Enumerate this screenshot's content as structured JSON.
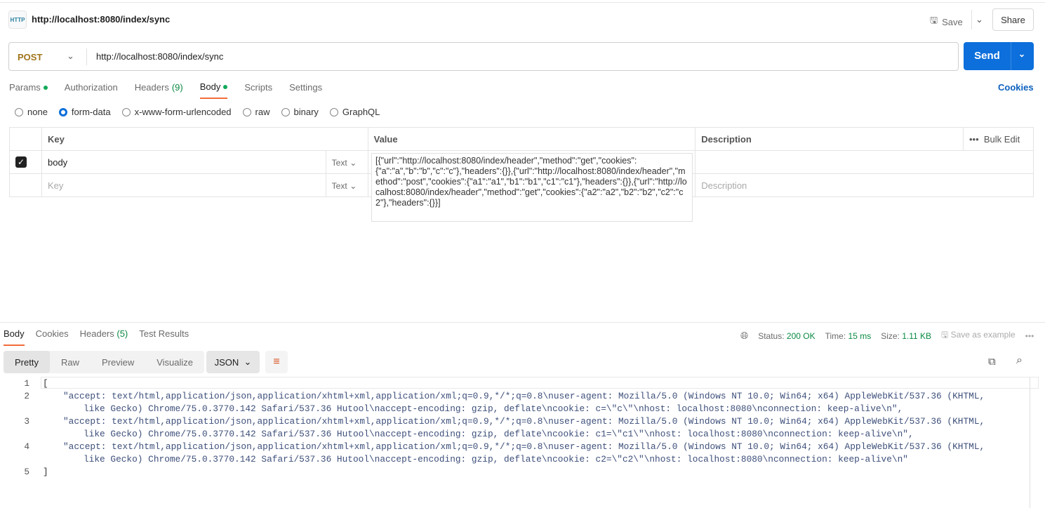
{
  "header": {
    "icon": "http-icon",
    "icon_text": "HTTP",
    "title": "http://localhost:8080/index/sync",
    "save_label": "Save",
    "share_label": "Share"
  },
  "request": {
    "method": "POST",
    "url": "http://localhost:8080/index/sync",
    "send_label": "Send"
  },
  "tabs": [
    {
      "label": "Params",
      "dot": true
    },
    {
      "label": "Authorization"
    },
    {
      "label": "Headers",
      "count": "(9)"
    },
    {
      "label": "Body",
      "dot": true,
      "active": true
    },
    {
      "label": "Scripts"
    },
    {
      "label": "Settings"
    }
  ],
  "cookies_link": "Cookies",
  "body_types": [
    "none",
    "form-data",
    "x-www-form-urlencoded",
    "raw",
    "binary",
    "GraphQL"
  ],
  "body_type_selected": "form-data",
  "table": {
    "headers": {
      "key": "Key",
      "value": "Value",
      "description": "Description",
      "bulk_edit": "Bulk Edit"
    },
    "rows": [
      {
        "checked": true,
        "key": "body",
        "type": "Text",
        "value": "[{\"url\":\"http://localhost:8080/index/header\",\"method\":\"get\",\"cookies\":{\"a\":\"a\",\"b\":\"b\",\"c\":\"c\"},\"headers\":{}},{\"url\":\"http://localhost:8080/index/header\",\"method\":\"post\",\"cookies\":{\"a1\":\"a1\",\"b1\":\"b1\",\"c1\":\"c1\"},\"headers\":{}},{\"url\":\"http://localhost:8080/index/header\",\"method\":\"get\",\"cookies\":{\"a2\":\"a2\",\"b2\":\"b2\",\"c2\":\"c2\"},\"headers\":{}}]",
        "description": ""
      }
    ],
    "placeholder": {
      "key": "Key",
      "type": "Text",
      "description": "Description"
    }
  },
  "response": {
    "tabs": [
      {
        "label": "Body",
        "active": true
      },
      {
        "label": "Cookies"
      },
      {
        "label": "Headers",
        "count": "(5)"
      },
      {
        "label": "Test Results"
      }
    ],
    "status_label": "Status:",
    "status": "200 OK",
    "time_label": "Time:",
    "time": "15 ms",
    "size_label": "Size:",
    "size": "1.11 KB",
    "save_example": "Save as example",
    "views": [
      "Pretty",
      "Raw",
      "Preview",
      "Visualize"
    ],
    "format": "JSON",
    "lines": [
      {
        "n": "1",
        "text": "["
      },
      {
        "n": "2",
        "text": "\"accept: text/html,application/json,application/xhtml+xml,application/xml;q=0.9,*/*;q=0.8\\nuser-agent: Mozilla/5.0 (Windows NT 10.0; Win64; x64) AppleWebKit/537.36 (KHTML, like Gecko) Chrome/75.0.3770.142 Safari/537.36 Hutool\\naccept-encoding: gzip, deflate\\ncookie: c=\\\"c\\\"\\nhost: localhost:8080\\nconnection: keep-alive\\n\","
      },
      {
        "n": "3",
        "text": "\"accept: text/html,application/json,application/xhtml+xml,application/xml;q=0.9,*/*;q=0.8\\nuser-agent: Mozilla/5.0 (Windows NT 10.0; Win64; x64) AppleWebKit/537.36 (KHTML, like Gecko) Chrome/75.0.3770.142 Safari/537.36 Hutool\\naccept-encoding: gzip, deflate\\ncookie: c1=\\\"c1\\\"\\nhost: localhost:8080\\nconnection: keep-alive\\n\","
      },
      {
        "n": "4",
        "text": "\"accept: text/html,application/json,application/xhtml+xml,application/xml;q=0.9,*/*;q=0.8\\nuser-agent: Mozilla/5.0 (Windows NT 10.0; Win64; x64) AppleWebKit/537.36 (KHTML, like Gecko) Chrome/75.0.3770.142 Safari/537.36 Hutool\\naccept-encoding: gzip, deflate\\ncookie: c2=\\\"c2\\\"\\nhost: localhost:8080\\nconnection: keep-alive\\n\""
      },
      {
        "n": "5",
        "text": "]"
      }
    ]
  },
  "colors": {
    "accent": "#0c6fdb",
    "active_tab": "#f26b3a",
    "method": "#a0741a",
    "status_ok": "#0a8a43"
  }
}
